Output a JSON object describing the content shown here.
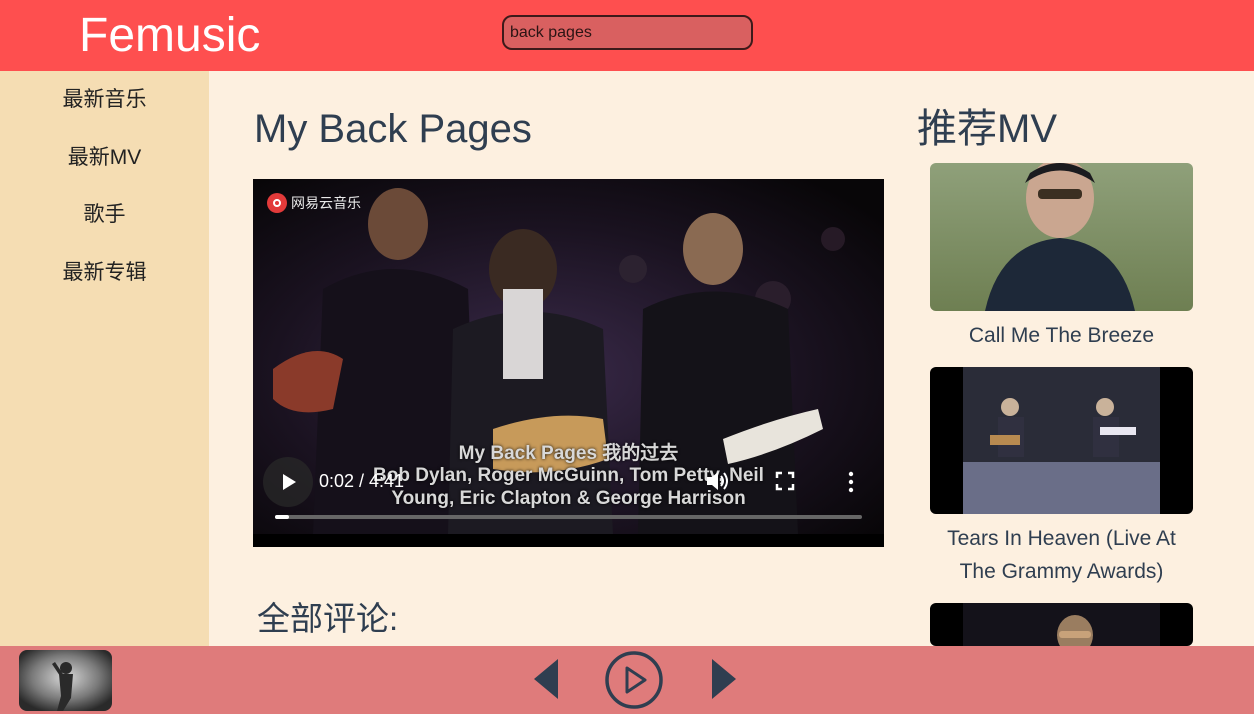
{
  "header": {
    "logo": "Femusic",
    "search_value": "back pages"
  },
  "sidebar": {
    "items": [
      {
        "label": "最新音乐"
      },
      {
        "label": "最新MV"
      },
      {
        "label": "歌手"
      },
      {
        "label": "最新专辑"
      }
    ]
  },
  "main": {
    "mv_title": "My Back Pages",
    "player": {
      "watermark": "网易云音乐",
      "subtitle_line1": "My Back Pages 我的过去",
      "subtitle_line2": "Bob Dylan, Roger McGuinn, Tom Petty, Neil",
      "subtitle_line3": "Young, Eric Clapton & George Harrison",
      "time": "0:02 / 4:41",
      "progress": 0.024
    },
    "comments_title": "全部评论:"
  },
  "recommend": {
    "title": "推荐MV",
    "items": [
      {
        "label": "Call Me The Breeze"
      },
      {
        "label": "Tears In Heaven (Live At The Grammy Awards)"
      },
      {
        "label": ""
      }
    ]
  },
  "footer": {
    "icons": [
      "album-cover",
      "prev-icon",
      "play-circle-icon",
      "next-icon"
    ]
  },
  "colors": {
    "header_bg": "#fe4f4f",
    "sidebar_bg": "#f5ddb3",
    "main_bg": "#fdf0e0",
    "footer_bg": "#df7b7b",
    "text_dark": "#2f3e50"
  }
}
